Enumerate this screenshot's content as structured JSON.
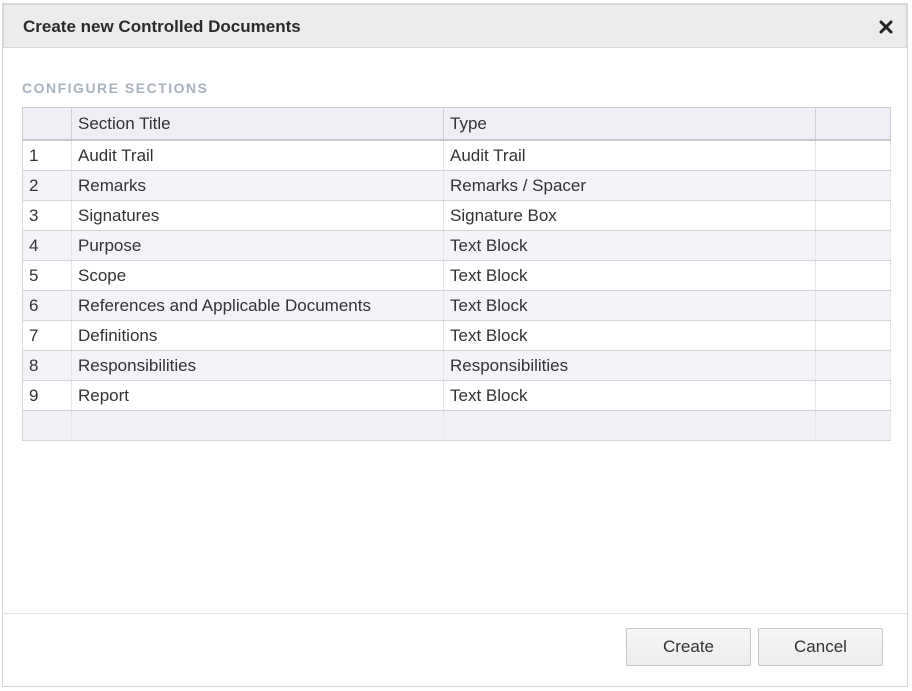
{
  "dialog": {
    "title": "Create new Controlled Documents",
    "close_icon": "close-x-icon"
  },
  "section": {
    "heading": "CONFIGURE SECTIONS"
  },
  "table": {
    "columns": [
      "",
      "Section Title",
      "Type",
      ""
    ],
    "rows": [
      {
        "num": "1",
        "title": "Audit Trail",
        "type": "Audit Trail"
      },
      {
        "num": "2",
        "title": "Remarks",
        "type": "Remarks / Spacer"
      },
      {
        "num": "3",
        "title": "Signatures",
        "type": "Signature Box"
      },
      {
        "num": "4",
        "title": "Purpose",
        "type": "Text Block"
      },
      {
        "num": "5",
        "title": "Scope",
        "type": "Text Block"
      },
      {
        "num": "6",
        "title": "References and Applicable Documents",
        "type": "Text Block"
      },
      {
        "num": "7",
        "title": "Definitions",
        "type": "Text Block"
      },
      {
        "num": "8",
        "title": "Responsibilities",
        "type": "Responsibilities"
      },
      {
        "num": "9",
        "title": "Report",
        "type": "Text Block"
      }
    ]
  },
  "footer": {
    "create_label": "Create",
    "cancel_label": "Cancel"
  }
}
